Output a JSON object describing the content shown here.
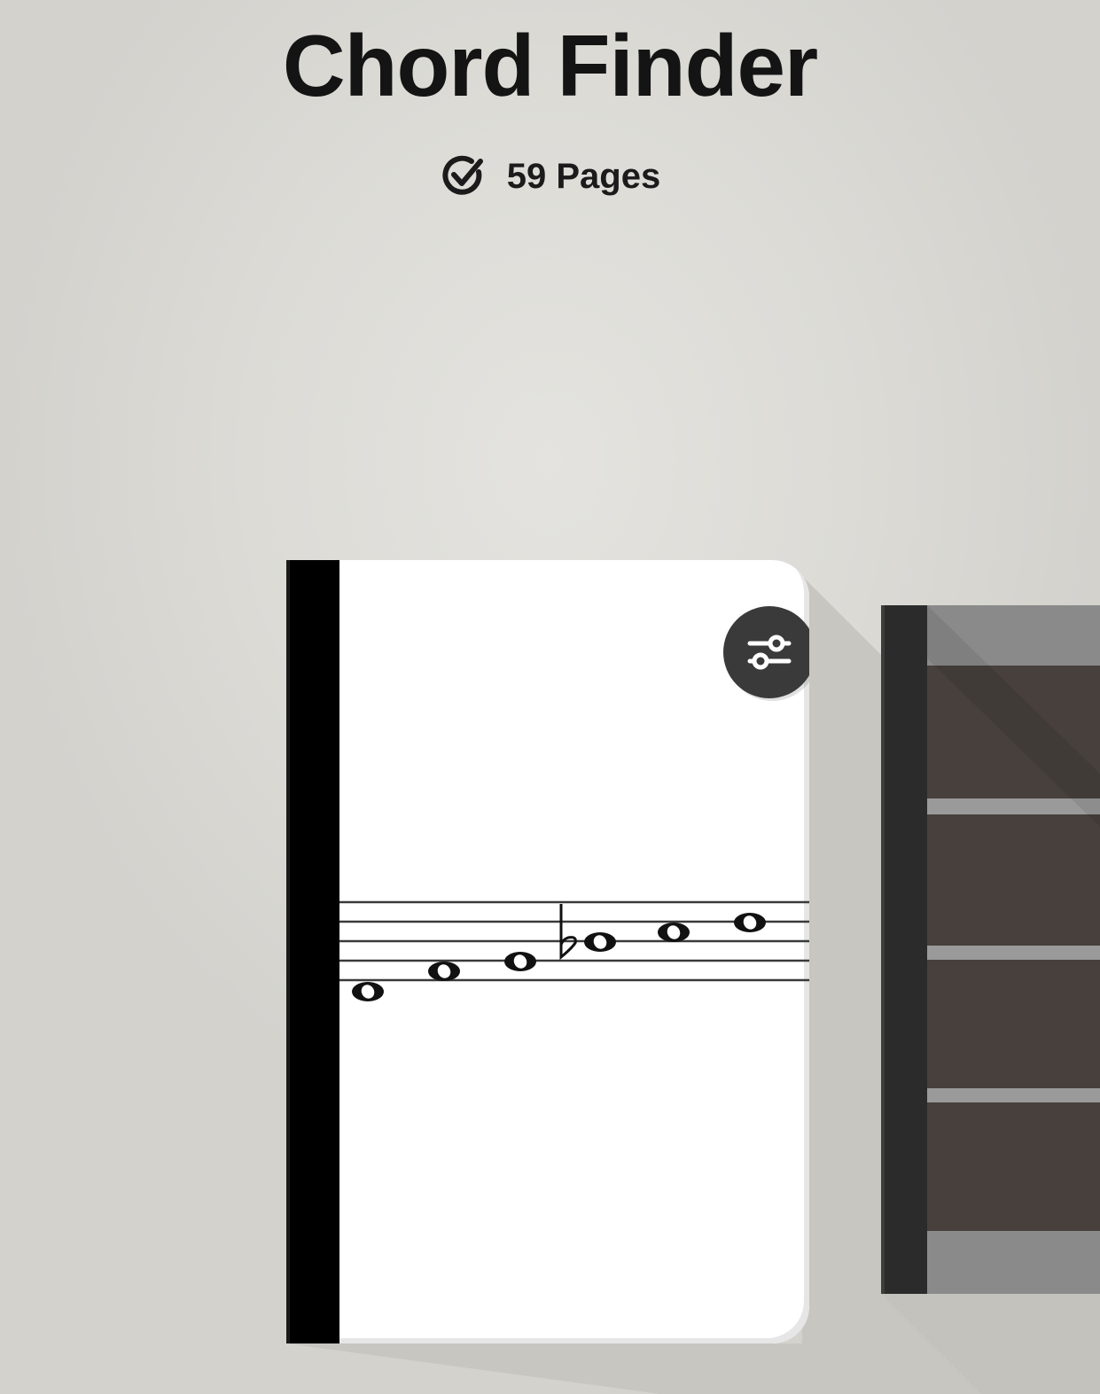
{
  "header": {
    "title": "Chord Finder",
    "page_count": "59 Pages",
    "badge_icon": "check-circle-icon"
  },
  "notebook": {
    "settings_icon": "sliders-icon",
    "cover_art": "music-staff-ascending-notes"
  },
  "next_notebook": {
    "cover_art": "guitar-fretboard"
  },
  "colors": {
    "background": "#dcdbd6",
    "title": "#141414",
    "spine": "#000000",
    "button": "#3a3a3a"
  }
}
